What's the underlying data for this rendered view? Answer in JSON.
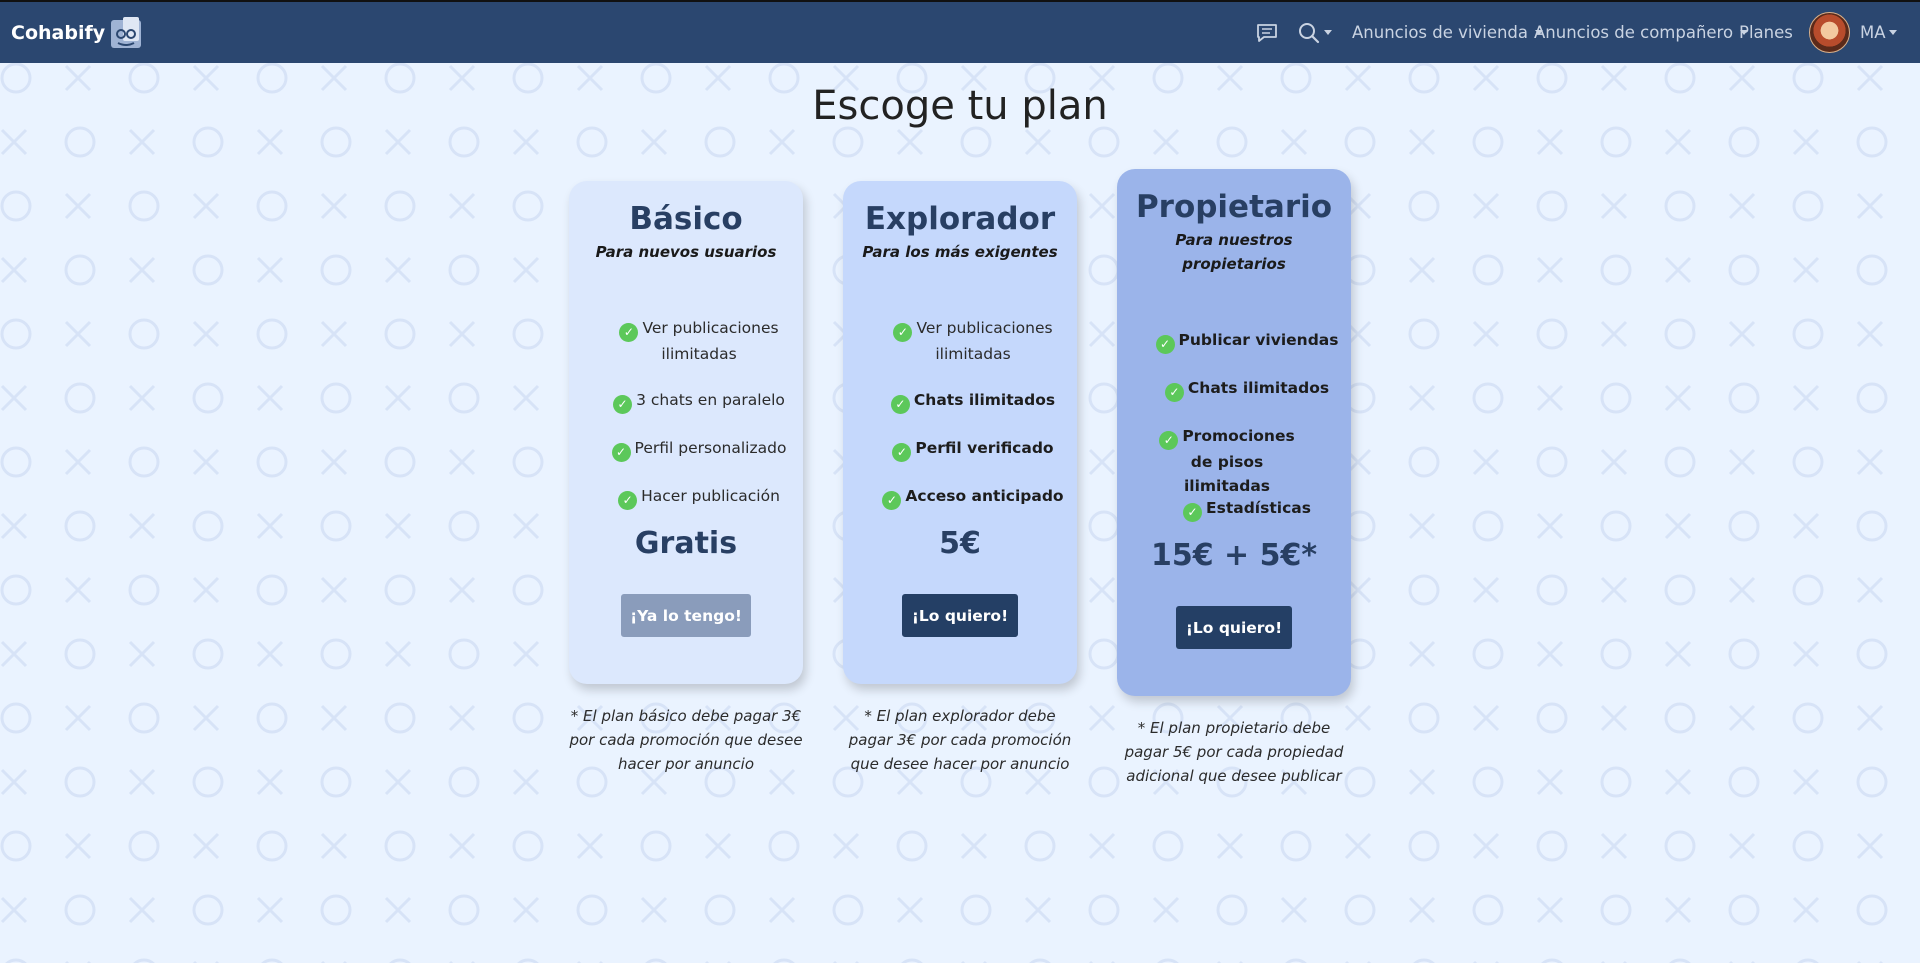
{
  "navbar": {
    "brand": "Cohabify",
    "brand_logo_icon": "two-faces-logo-icon",
    "chat_icon": "chat-icon",
    "search_icon": "search-icon",
    "housing_label": "Anuncios de vivienda",
    "roommate_label": "Anuncios de compañero",
    "plans_label": "Planes",
    "user_initials": "MA",
    "colors": {
      "background": "#2b4770",
      "text": "#c9d3e2"
    }
  },
  "page": {
    "title": "Escoge tu plan"
  },
  "plans": [
    {
      "name": "Básico",
      "subtitle": "Para nuevos usuarios",
      "features": [
        "Ver publicaciones ilimitadas",
        "3 chats en paralelo",
        "Perfil personalizado",
        "Hacer publicación"
      ],
      "price": "Gratis",
      "button": "¡Ya lo tengo!",
      "note": "* El plan básico debe pagar 3€ por cada promoción que desee hacer por anuncio",
      "color": "#dce8fd"
    },
    {
      "name": "Explorador",
      "subtitle": "Para los más exigentes",
      "features": [
        "Ver publicaciones ilimitadas",
        "Chats ilimitados",
        "Perfil verificado",
        "Acceso anticipado"
      ],
      "price": "5€",
      "button": "¡Lo quiero!",
      "note": "* El plan explorador debe pagar 3€ por cada promoción que desee hacer por anuncio",
      "color": "#c5d8fc"
    },
    {
      "name": "Propietario",
      "subtitle": "Para nuestros propietarios",
      "features": [
        "Publicar viviendas",
        "Chats ilimitados",
        "Promociones de pisos ilimitadas",
        "Estadísticas"
      ],
      "price": "15€ + 5€*",
      "button": "¡Lo quiero!",
      "note": "* El plan propietario debe pagar 5€ por cada propiedad adicional que desee publicar",
      "color": "#9bb4ea"
    }
  ],
  "colors": {
    "page_background": "#eaf3ff",
    "check": "#5cc85a",
    "primary_button": "#243f65",
    "disabled_button": "#8a9cbb"
  }
}
